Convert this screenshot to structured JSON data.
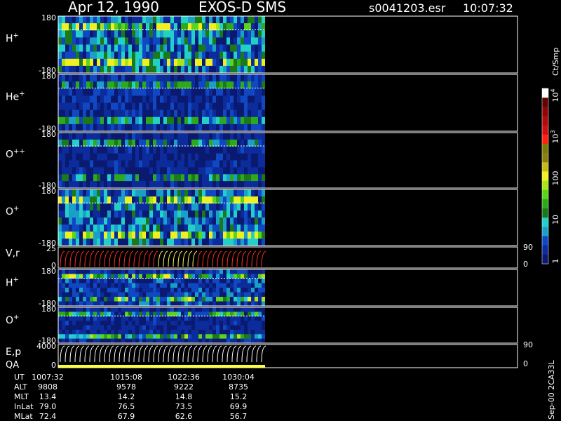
{
  "header": {
    "date": "Apr 12, 1990",
    "instrument": "EXOS-D SMS",
    "file": "s0041203.esr",
    "time": "10:07:32"
  },
  "colorbar": {
    "unit": "Ct/Smp",
    "ticks": [
      {
        "label": "1",
        "exp": "",
        "value": 1
      },
      {
        "label": "10",
        "exp": "",
        "value": 10
      },
      {
        "label": "100",
        "exp": "",
        "value": 100
      },
      {
        "label": "10",
        "exp": "3",
        "value": 1000
      },
      {
        "label": "10",
        "exp": "4",
        "value": 10000
      }
    ],
    "colors": [
      "#0a1a70",
      "#0c2c9c",
      "#1048c4",
      "#1aa0c8",
      "#22d0c8",
      "#1a7a1a",
      "#2caa1c",
      "#5cd41c",
      "#a8e418",
      "#f0f020",
      "#c8b818",
      "#8a8010",
      "#7a7a0c",
      "#ff2010",
      "#d01010",
      "#b00c0c",
      "#8c0808",
      "#600404",
      "#ffffff"
    ]
  },
  "chart_data": {
    "type": "heatmap",
    "time_range": [
      "10:07:32",
      "10:36:00"
    ],
    "data_end": "10:31:30",
    "panels": [
      {
        "name": "H",
        "sup": "+",
        "kind": "pitch",
        "ymin": -180,
        "ymax": 180,
        "ymin_label": "-180",
        "ymax_label": "180",
        "level": 0.55
      },
      {
        "name": "He",
        "sup": "+",
        "kind": "pitch",
        "ymin": -180,
        "ymax": 180,
        "ymin_label": "-180",
        "ymax_label": "180",
        "level": 0.25
      },
      {
        "name": "O",
        "sup": "++",
        "kind": "pitch",
        "ymin": -180,
        "ymax": 180,
        "ymin_label": "-180",
        "ymax_label": "180",
        "level": 0.2
      },
      {
        "name": "O",
        "sup": "+",
        "kind": "pitch",
        "ymin": -180,
        "ymax": 180,
        "ymin_label": "-180",
        "ymax_label": "180",
        "level": 0.5
      },
      {
        "name": "V,r",
        "sup": "",
        "kind": "line",
        "ymin": 0,
        "ymax": 25,
        "ymin_label": "0",
        "ymax_label": "25",
        "right_top": "90",
        "right_bottom": "0"
      },
      {
        "name": "H",
        "sup": "+",
        "kind": "pitch",
        "ymin": -180,
        "ymax": 180,
        "ymin_label": "-180",
        "ymax_label": "180",
        "level": 0.3
      },
      {
        "name": "O",
        "sup": "+",
        "kind": "pitch",
        "ymin": -180,
        "ymax": 180,
        "ymin_label": "-180",
        "ymax_label": "180",
        "level": 0.2
      },
      {
        "name": "E,p",
        "sup": "",
        "name2": "QA",
        "kind": "energy",
        "ymin": 0,
        "ymax": 4000,
        "ymin_label": "0",
        "ymax_label": "4000",
        "right_top": "90",
        "right_bottom": "0"
      }
    ]
  },
  "orbit_table": {
    "rows": [
      {
        "label": "UT",
        "values": [
          "1007:32",
          "1015:08",
          "1022:36",
          "1030:04"
        ]
      },
      {
        "label": "ALT",
        "values": [
          "9808",
          "9578",
          "9222",
          "8735"
        ]
      },
      {
        "label": "MLT",
        "values": [
          "13.4",
          "14.2",
          "14.8",
          "15.2"
        ]
      },
      {
        "label": "InLat",
        "values": [
          "79.0",
          "76.5",
          "73.5",
          "69.9"
        ]
      },
      {
        "label": "MLat",
        "values": [
          "72.4",
          "67.9",
          "62.6",
          "56.7"
        ]
      }
    ]
  },
  "footer_code": "Sep-00 2CA33L"
}
